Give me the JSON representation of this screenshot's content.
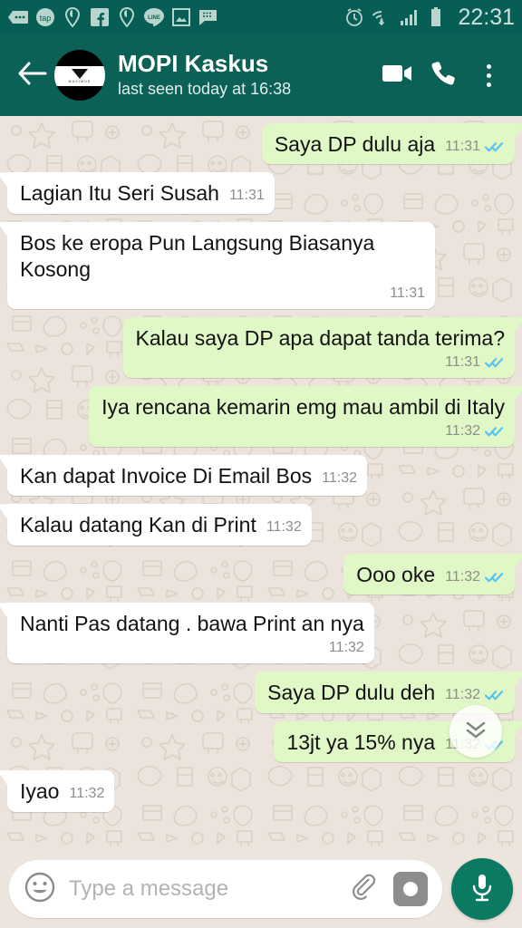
{
  "status_bar": {
    "clock": "22:31",
    "left_icons": [
      "messages-icon",
      "tap-icon",
      "pin-icon",
      "facebook-icon",
      "pin-icon-2",
      "line-icon",
      "gallery-icon",
      "blackberry-messenger-icon"
    ],
    "right_icons": [
      "alarm-icon",
      "wifi-icon",
      "signal-icon",
      "battery-icon"
    ],
    "bar_color": "#075e54"
  },
  "header": {
    "back_icon": "back-arrow-icon",
    "avatar_label": "MAXIMUS",
    "title": "MOPI Kaskus",
    "subtitle": "last seen today at 16:38",
    "video_icon": "video-call-icon",
    "call_icon": "voice-call-icon",
    "menu_icon": "overflow-menu-icon",
    "bar_color": "#0c6157"
  },
  "chat": {
    "background_color": "#ece4dc",
    "incoming_bubble_color": "#ffffff",
    "outgoing_bubble_color": "#e0f7c6",
    "read_tick_color": "#4fc3f7",
    "messages": [
      {
        "id": "m1",
        "direction": "out",
        "text": "Saya DP dulu aja",
        "time": "11:31",
        "status": "read",
        "meta_wrap": false
      },
      {
        "id": "m2",
        "direction": "in",
        "text": "Lagian Itu Seri Susah",
        "time": "11:31",
        "status": "none",
        "meta_wrap": false
      },
      {
        "id": "m3",
        "direction": "in",
        "text": "Bos ke eropa Pun Langsung Biasanya Kosong",
        "time": "11:31",
        "status": "none",
        "meta_wrap": true
      },
      {
        "id": "m4",
        "direction": "out",
        "text": "Kalau saya DP apa dapat tanda terima?",
        "time": "11:31",
        "status": "read",
        "meta_wrap": true
      },
      {
        "id": "m5",
        "direction": "out",
        "text": "Iya rencana kemarin emg mau ambil di Italy",
        "time": "11:32",
        "status": "read",
        "meta_wrap": true
      },
      {
        "id": "m6",
        "direction": "in",
        "text": "Kan dapat Invoice Di Email Bos",
        "time": "11:32",
        "status": "none",
        "meta_wrap": false
      },
      {
        "id": "m7",
        "direction": "in",
        "text": "Kalau datang Kan di Print",
        "time": "11:32",
        "status": "none",
        "meta_wrap": false
      },
      {
        "id": "m8",
        "direction": "out",
        "text": "Ooo oke",
        "time": "11:32",
        "status": "read",
        "meta_wrap": false
      },
      {
        "id": "m9",
        "direction": "in",
        "text": "Nanti Pas datang . bawa Print an nya",
        "time": "11:32",
        "status": "none",
        "meta_wrap": true
      },
      {
        "id": "m10",
        "direction": "out",
        "text": "Saya DP dulu deh",
        "time": "11:32",
        "status": "read",
        "meta_wrap": false
      },
      {
        "id": "m11",
        "direction": "out",
        "text": "13jt ya 15% nya",
        "time": "11:32",
        "status": "read",
        "meta_wrap": false
      },
      {
        "id": "m12",
        "direction": "in",
        "text": "Iyao",
        "time": "11:32",
        "status": "none",
        "meta_wrap": false
      }
    ]
  },
  "scroll_down_button": {
    "icon": "double-chevron-down-icon"
  },
  "input_bar": {
    "emoji_icon": "emoji-smiley-icon",
    "placeholder": "Type a message",
    "value": "",
    "attach_icon": "paperclip-icon",
    "camera_icon": "camera-icon",
    "mic_icon": "microphone-icon",
    "mic_button_color": "#0a7a63"
  }
}
